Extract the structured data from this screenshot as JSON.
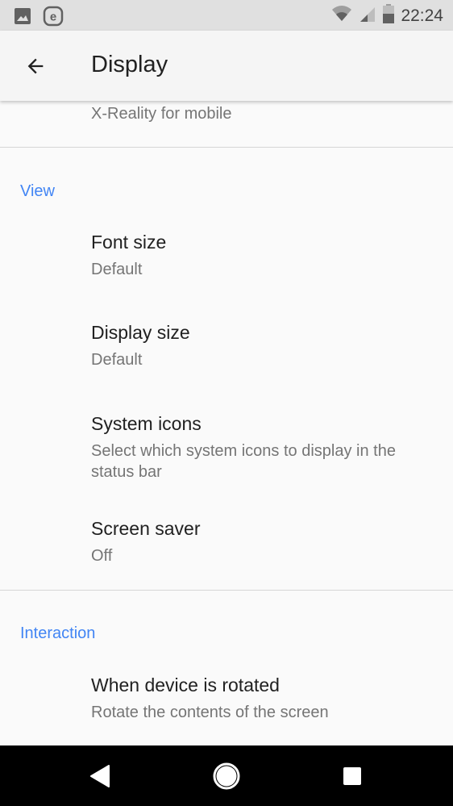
{
  "status_bar": {
    "time": "22:24",
    "left_icons": [
      "image-notification-icon",
      "e-app-notification-icon"
    ],
    "right_icons": [
      "wifi-icon",
      "cell-signal-icon",
      "battery-icon"
    ]
  },
  "app_bar": {
    "back_icon": "arrow-back-icon",
    "title": "Display"
  },
  "partial_item": {
    "summary": "X-Reality for mobile"
  },
  "sections": [
    {
      "header": "View",
      "items": [
        {
          "title": "Font size",
          "summary": "Default"
        },
        {
          "title": "Display size",
          "summary": "Default"
        },
        {
          "title": "System icons",
          "summary": "Select which system icons to display in the status bar"
        },
        {
          "title": "Screen saver",
          "summary": "Off"
        }
      ]
    },
    {
      "header": "Interaction",
      "items": [
        {
          "title": "When device is rotated",
          "summary": "Rotate the contents of the screen"
        }
      ]
    }
  ],
  "nav_bar": {
    "buttons": [
      "back-icon",
      "home-icon",
      "recents-icon"
    ]
  },
  "colors": {
    "accent": "#4285f4",
    "status_bar_bg": "#e0e0e0",
    "app_bar_bg": "#f5f5f5",
    "background": "#fafafa",
    "title_text": "#212121",
    "summary_text": "#757575"
  }
}
